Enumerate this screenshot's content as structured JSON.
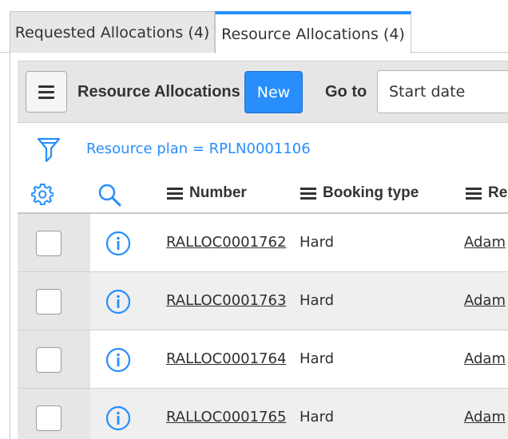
{
  "tabs": [
    {
      "label": "Requested Allocations (4)",
      "active": false
    },
    {
      "label": "Resource Allocations (4)",
      "active": true
    }
  ],
  "toolbar": {
    "menu_icon": "hamburger-menu-icon",
    "title": "Resource Allocations",
    "new_label": "New",
    "goto_label": "Go to",
    "goto_selected": "Start date"
  },
  "filter": {
    "icon": "funnel-icon",
    "text": "Resource plan = RPLN0001106"
  },
  "table": {
    "columns": [
      "Number",
      "Booking type",
      "Re"
    ],
    "rows": [
      {
        "number": "RALLOC0001762",
        "booking_type": "Hard",
        "resource": "Adam"
      },
      {
        "number": "RALLOC0001763",
        "booking_type": "Hard",
        "resource": "Adam"
      },
      {
        "number": "RALLOC0001764",
        "booking_type": "Hard",
        "resource": "Adam"
      },
      {
        "number": "RALLOC0001765",
        "booking_type": "Hard",
        "resource": "Adam"
      }
    ]
  },
  "colors": {
    "accent": "#278efc",
    "toolbar_bg": "#e6e6e6",
    "tab_inactive_bg": "#e7e7e7"
  }
}
